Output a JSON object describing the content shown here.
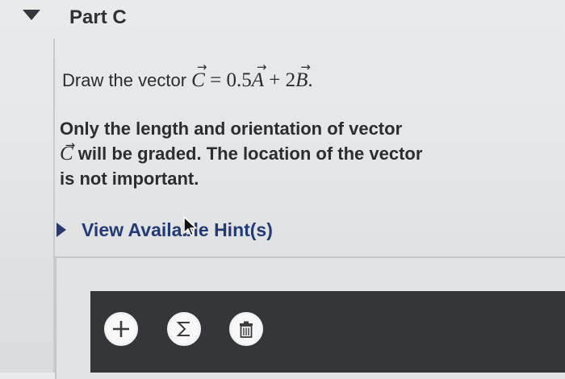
{
  "part": {
    "title": "Part C"
  },
  "question": {
    "prefix": "Draw the vector ",
    "c": "C",
    "eq": " = 0.5",
    "a": "A",
    "plus": " + 2",
    "b": "B",
    "end": ".",
    "arrow": "→"
  },
  "note": {
    "line1": "Only the length and orientation of vector",
    "c": "C",
    "line2": " will be graded. The location of the vector",
    "line3": "is not important."
  },
  "hint": {
    "label": "View Available Hint(s)"
  },
  "toolbar": {
    "buttons": [
      {
        "name": "add",
        "icon": "plus-icon"
      },
      {
        "name": "sum",
        "icon": "sigma-icon"
      },
      {
        "name": "delete",
        "icon": "trash-icon"
      }
    ]
  }
}
